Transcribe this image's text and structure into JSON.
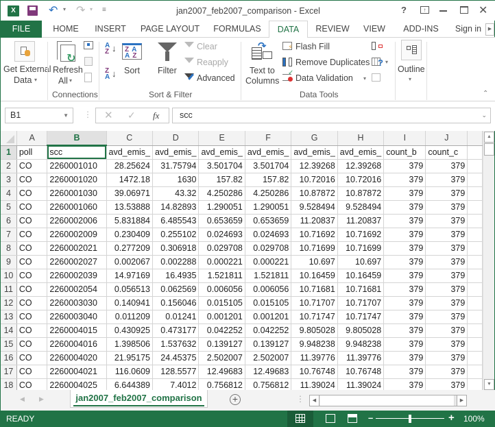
{
  "window": {
    "title": "jan2007_feb2007_comparison - Excel",
    "help": "?",
    "app_icon_label": "X"
  },
  "tabs": [
    {
      "label": "FILE"
    },
    {
      "label": "HOME"
    },
    {
      "label": "INSERT"
    },
    {
      "label": "PAGE LAYOUT"
    },
    {
      "label": "FORMULAS"
    },
    {
      "label": "DATA",
      "active": true
    },
    {
      "label": "REVIEW"
    },
    {
      "label": "VIEW"
    },
    {
      "label": "ADD-INS"
    }
  ],
  "sign_in": "Sign in",
  "ribbon": {
    "get_external_data": [
      "Get External",
      "Data"
    ],
    "refresh_all": [
      "Refresh",
      "All"
    ],
    "sort": "Sort",
    "filter": "Filter",
    "clear": "Clear",
    "reapply": "Reapply",
    "advanced": "Advanced",
    "text_to_columns": [
      "Text to",
      "Columns"
    ],
    "flash_fill": "Flash Fill",
    "remove_duplicates": "Remove Duplicates",
    "data_validation": "Data Validation",
    "outline": "Outline",
    "groups": {
      "connections": "Connections",
      "sort_filter": "Sort & Filter",
      "data_tools": "Data Tools"
    }
  },
  "formula_bar": {
    "name_box": "B1",
    "fx": "fx",
    "content": "scc"
  },
  "sheet": {
    "columns": [
      "A",
      "B",
      "C",
      "D",
      "E",
      "F",
      "G",
      "H",
      "I",
      "J"
    ],
    "selected_column": "B",
    "selected_row": "1",
    "header_row": [
      "poll",
      "scc",
      "avd_emis_",
      "avd_emis_",
      "avd_emis_",
      "avd_emis_",
      "avd_emis_",
      "avd_emis_",
      "count_b",
      "count_c"
    ],
    "rows": [
      {
        "n": "2",
        "cells": [
          "CO",
          "2260001010",
          "28.25624",
          "31.75794",
          "3.501704",
          "3.501704",
          "12.39268",
          "12.39268",
          "379",
          "379"
        ]
      },
      {
        "n": "3",
        "cells": [
          "CO",
          "2260001020",
          "1472.18",
          "1630",
          "157.82",
          "157.82",
          "10.72016",
          "10.72016",
          "379",
          "379"
        ]
      },
      {
        "n": "4",
        "cells": [
          "CO",
          "2260001030",
          "39.06971",
          "43.32",
          "4.250286",
          "4.250286",
          "10.87872",
          "10.87872",
          "379",
          "379"
        ]
      },
      {
        "n": "5",
        "cells": [
          "CO",
          "2260001060",
          "13.53888",
          "14.82893",
          "1.290051",
          "1.290051",
          "9.528494",
          "9.528494",
          "379",
          "379"
        ]
      },
      {
        "n": "6",
        "cells": [
          "CO",
          "2260002006",
          "5.831884",
          "6.485543",
          "0.653659",
          "0.653659",
          "11.20837",
          "11.20837",
          "379",
          "379"
        ]
      },
      {
        "n": "7",
        "cells": [
          "CO",
          "2260002009",
          "0.230409",
          "0.255102",
          "0.024693",
          "0.024693",
          "10.71692",
          "10.71692",
          "379",
          "379"
        ]
      },
      {
        "n": "8",
        "cells": [
          "CO",
          "2260002021",
          "0.277209",
          "0.306918",
          "0.029708",
          "0.029708",
          "10.71699",
          "10.71699",
          "379",
          "379"
        ]
      },
      {
        "n": "9",
        "cells": [
          "CO",
          "2260002027",
          "0.002067",
          "0.002288",
          "0.000221",
          "0.000221",
          "10.697",
          "10.697",
          "379",
          "379"
        ]
      },
      {
        "n": "10",
        "cells": [
          "CO",
          "2260002039",
          "14.97169",
          "16.4935",
          "1.521811",
          "1.521811",
          "10.16459",
          "10.16459",
          "379",
          "379"
        ]
      },
      {
        "n": "11",
        "cells": [
          "CO",
          "2260002054",
          "0.056513",
          "0.062569",
          "0.006056",
          "0.006056",
          "10.71681",
          "10.71681",
          "379",
          "379"
        ]
      },
      {
        "n": "12",
        "cells": [
          "CO",
          "2260003030",
          "0.140941",
          "0.156046",
          "0.015105",
          "0.015105",
          "10.71707",
          "10.71707",
          "379",
          "379"
        ]
      },
      {
        "n": "13",
        "cells": [
          "CO",
          "2260003040",
          "0.011209",
          "0.01241",
          "0.001201",
          "0.001201",
          "10.71747",
          "10.71747",
          "379",
          "379"
        ]
      },
      {
        "n": "14",
        "cells": [
          "CO",
          "2260004015",
          "0.430925",
          "0.473177",
          "0.042252",
          "0.042252",
          "9.805028",
          "9.805028",
          "379",
          "379"
        ]
      },
      {
        "n": "15",
        "cells": [
          "CO",
          "2260004016",
          "1.398506",
          "1.537632",
          "0.139127",
          "0.139127",
          "9.948238",
          "9.948238",
          "379",
          "379"
        ]
      },
      {
        "n": "16",
        "cells": [
          "CO",
          "2260004020",
          "21.95175",
          "24.45375",
          "2.502007",
          "2.502007",
          "11.39776",
          "11.39776",
          "379",
          "379"
        ]
      },
      {
        "n": "17",
        "cells": [
          "CO",
          "2260004021",
          "116.0609",
          "128.5577",
          "12.49683",
          "12.49683",
          "10.76748",
          "10.76748",
          "379",
          "379"
        ]
      },
      {
        "n": "18",
        "cells": [
          "CO",
          "2260004025",
          "6.644389",
          "7.4012",
          "0.756812",
          "0.756812",
          "11.39024",
          "11.39024",
          "379",
          "379"
        ]
      }
    ]
  },
  "sheet_tab": "jan2007_feb2007_comparison",
  "status": {
    "mode": "READY",
    "zoom": "100%",
    "zoom_fraction": 0.5
  },
  "colors": {
    "accent": "#217346"
  }
}
